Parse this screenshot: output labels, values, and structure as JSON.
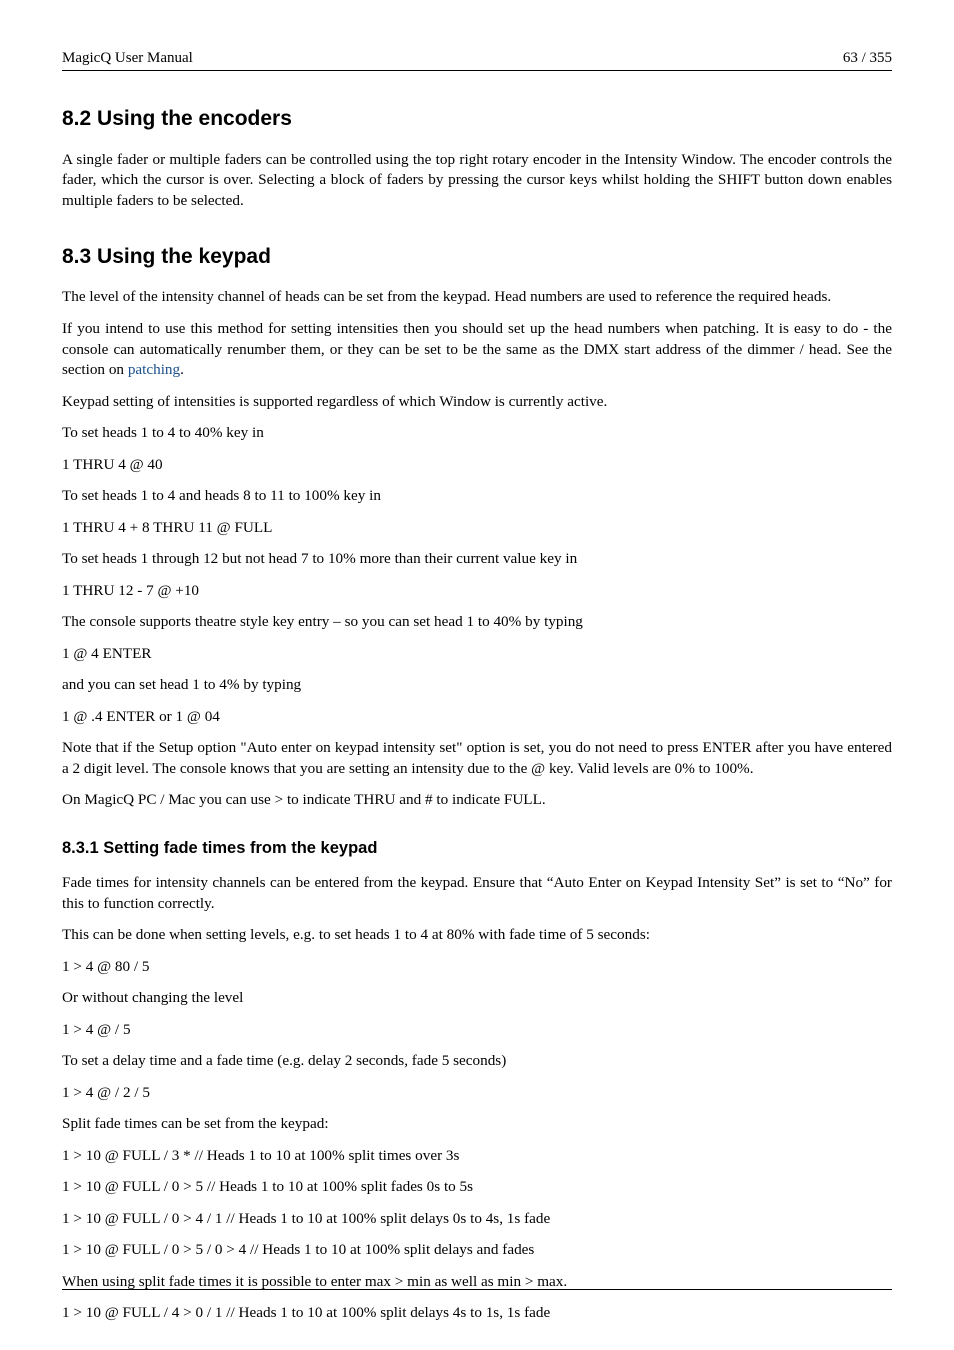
{
  "header": {
    "left": "MagicQ User Manual",
    "right": "63 / 355"
  },
  "s82": {
    "heading": "8.2   Using the encoders",
    "p1": "A single fader or multiple faders can be controlled using the top right rotary encoder in the Intensity Window. The encoder controls the fader, which the cursor is over. Selecting a block of faders by pressing the cursor keys whilst holding the SHIFT button down enables multiple faders to be selected."
  },
  "s83": {
    "heading": "8.3   Using the keypad",
    "p1": "The level of the intensity channel of heads can be set from the keypad. Head numbers are used to reference the required heads.",
    "p2a": "If you intend to use this method for setting intensities then you should set up the head numbers when patching. It is easy to do - the console can automatically renumber them, or they can be set to be the same as the DMX start address of the dimmer / head. See the section on ",
    "p2link": "patching",
    "p2b": ".",
    "p3": "Keypad setting of intensities is supported regardless of which Window is currently active.",
    "p4": "To set heads 1 to 4 to 40% key in",
    "p5": "1 THRU 4 @ 40",
    "p6": "To set heads 1 to 4 and heads 8 to 11 to 100% key in",
    "p7": "1 THRU 4 + 8 THRU 11 @ FULL",
    "p8": "To set heads 1 through 12 but not head 7 to 10% more than their current value key in",
    "p9": "1 THRU 12 - 7 @ +10",
    "p10": "The console supports theatre style key entry – so you can set head 1 to 40% by typing",
    "p11": "1 @ 4 ENTER",
    "p12": "and you can set head 1 to 4% by typing",
    "p13": "1 @ .4 ENTER or 1 @ 04",
    "p14": "Note that if the Setup option \"Auto enter on keypad intensity set\" option is set, you do not need to press ENTER after you have entered a 2 digit level. The console knows that you are setting an intensity due to the @ key. Valid levels are 0% to 100%.",
    "p15": "On MagicQ PC / Mac you can use > to indicate THRU and # to indicate FULL."
  },
  "s831": {
    "heading": "8.3.1   Setting fade times from the keypad",
    "p1": "Fade times for intensity channels can be entered from the keypad. Ensure that “Auto Enter on Keypad Intensity Set” is set to “No” for this to function correctly.",
    "p2": "This can be done when setting levels, e.g. to set heads 1 to 4 at 80% with fade time of 5 seconds:",
    "p3": "1 > 4 @ 80 / 5",
    "p4": "Or without changing the level",
    "p5": "1 > 4 @ / 5",
    "p6": "To set a delay time and a fade time (e.g. delay 2 seconds, fade 5 seconds)",
    "p7": "1 > 4 @ / 2 / 5",
    "p8": "Split fade times can be set from the keypad:",
    "p9": "1 > 10 @ FULL / 3 * // Heads 1 to 10 at 100% split times over 3s",
    "p10": "1 > 10 @ FULL / 0 > 5 // Heads 1 to 10 at 100% split fades 0s to 5s",
    "p11": "1 > 10 @ FULL / 0 > 4 / 1 // Heads 1 to 10 at 100% split delays 0s to 4s, 1s fade",
    "p12": "1 > 10 @ FULL / 0 > 5 / 0 > 4 // Heads 1 to 10 at 100% split delays and fades",
    "p13": "When using split fade times it is possible to enter max > min as well as min > max.",
    "p14": "1 > 10 @ FULL / 4 > 0 / 1 // Heads 1 to 10 at 100% split delays 4s to 1s, 1s fade"
  }
}
